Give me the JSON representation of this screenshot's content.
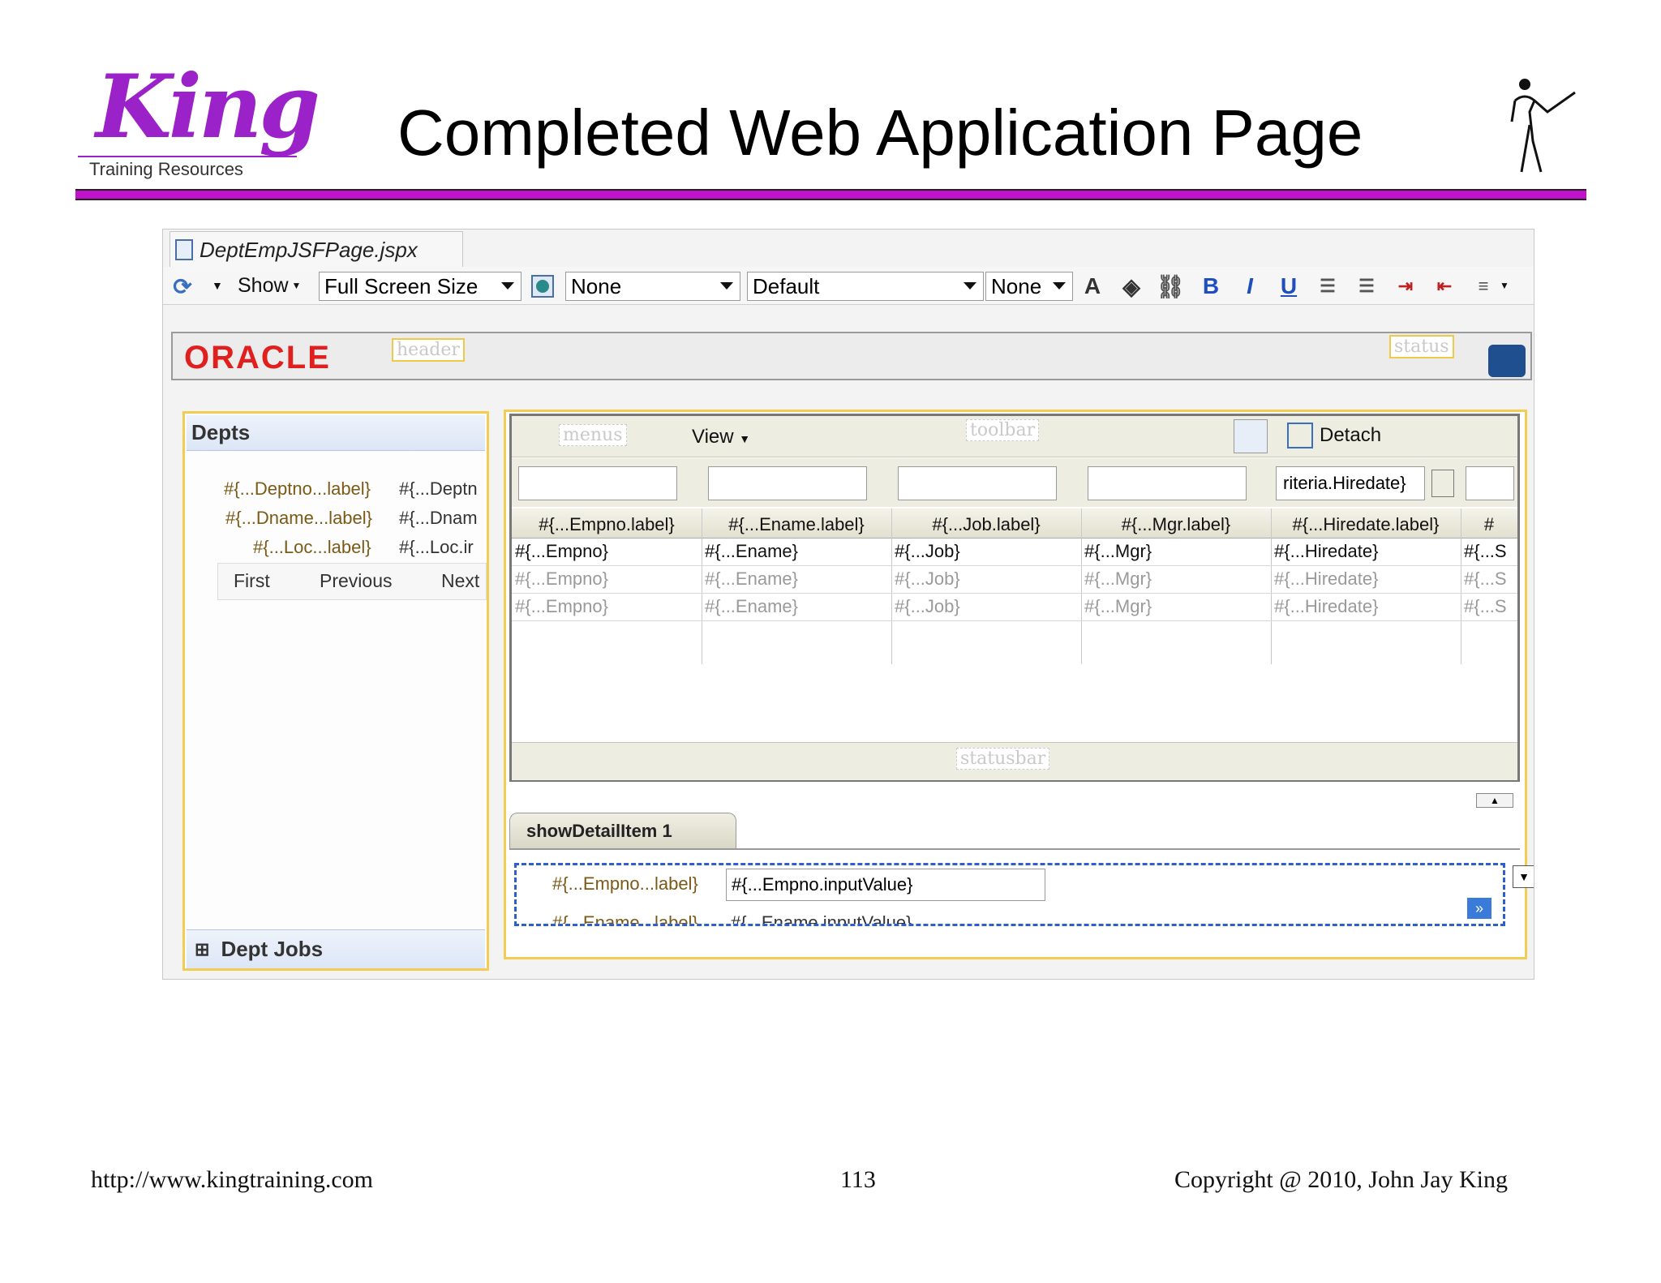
{
  "slide": {
    "logo_main": "King",
    "logo_sub": "Training Resources",
    "title": "Completed Web Application Page"
  },
  "window": {
    "tab_label": "DeptEmpJSFPage.jspx"
  },
  "toolbar": {
    "show_label": "Show",
    "screen_size": "Full Screen Size",
    "combo_none_1": "None",
    "combo_default": "Default",
    "combo_none_2": "None",
    "bold": "B",
    "italic": "I",
    "underline": "U"
  },
  "header_band": {
    "oracle_logo": "ORACLE",
    "header_facet": "header",
    "status_facet": "status"
  },
  "depts_panel": {
    "title": "Depts",
    "fields": [
      {
        "label": "#{...Deptno...label}",
        "value": "#{...Deptn"
      },
      {
        "label": "#{...Dname...label}",
        "value": "#{...Dnam"
      },
      {
        "label": "#{...Loc...label}",
        "value": "#{...Loc.ir"
      }
    ],
    "nav": {
      "first": "First",
      "previous": "Previous",
      "next": "Next"
    },
    "dept_jobs": "Dept Jobs"
  },
  "emp_table": {
    "menus_facet": "menus",
    "view_menu": "View",
    "toolbar_facet": "toolbar",
    "detach": "Detach",
    "filter_value": "riteria.Hiredate}",
    "columns": [
      "#{...Empno.label}",
      "#{...Ename.label}",
      "#{...Job.label}",
      "#{...Mgr.label}",
      "#{...Hiredate.label}",
      "#"
    ],
    "rows": [
      [
        "#{...Empno}",
        "#{...Ename}",
        "#{...Job}",
        "#{...Mgr}",
        "#{...Hiredate}",
        "#{...S"
      ],
      [
        "#{...Empno}",
        "#{...Ename}",
        "#{...Job}",
        "#{...Mgr}",
        "#{...Hiredate}",
        "#{...S"
      ],
      [
        "#{...Empno}",
        "#{...Ename}",
        "#{...Job}",
        "#{...Mgr}",
        "#{...Hiredate}",
        "#{...S"
      ]
    ],
    "statusbar_facet": "statusbar"
  },
  "detail": {
    "tab_label": "showDetailItem 1",
    "empno_label": "#{...Empno...label}",
    "empno_value": "#{...Empno.inputValue}",
    "ename_label": "#{...Ename...label}",
    "ename_value": "#{...Ename.inputValue}"
  },
  "footer": {
    "url": "http://www.kingtraining.com",
    "page": "113",
    "copyright": "Copyright @ 2010, John Jay King"
  }
}
